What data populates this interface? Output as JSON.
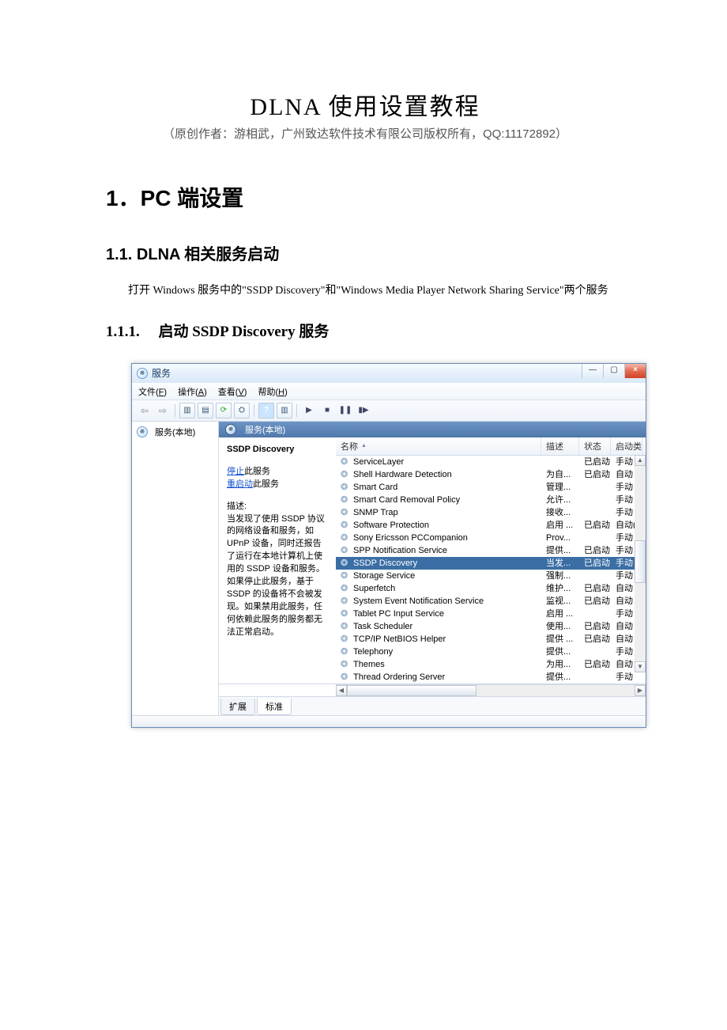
{
  "doc": {
    "title": "DLNA 使用设置教程",
    "subtitle": "（原创作者：游相武，广州致达软件技术有限公司版权所有，QQ:11172892）",
    "h1": "1．PC 端设置",
    "h2": "1.1. DLNA 相关服务启动",
    "p1": "打开 Windows 服务中的\"SSDP Discovery\"和\"Windows Media Player Network Sharing Service\"两个服务",
    "h3": "1.1.1.　 启动 SSDP Discovery 服务"
  },
  "win": {
    "title": "服务",
    "btn_min": "—",
    "btn_max": "▢",
    "btn_close": "×",
    "menus": {
      "file": {
        "label": "文件",
        "hot": "F"
      },
      "action": {
        "label": "操作",
        "hot": "A"
      },
      "view": {
        "label": "查看",
        "hot": "V"
      },
      "help": {
        "label": "帮助",
        "hot": "H"
      }
    },
    "nav_label": "服务(本地)",
    "caption_label": "服务(本地)",
    "detail": {
      "selected_name": "SSDP Discovery",
      "stop_link": "停止",
      "stop_suffix": "此服务",
      "restart_link": "重启动",
      "restart_suffix": "此服务",
      "desc_label": "描述:",
      "desc_text": "当发现了使用 SSDP 协议的网络设备和服务，如 UPnP 设备，同时还报告了运行在本地计算机上使用的 SSDP 设备和服务。如果停止此服务，基于 SSDP 的设备将不会被发现。如果禁用此服务，任何依赖此服务的服务都无法正常启动。"
    },
    "columns": {
      "name": "名称",
      "desc": "描述",
      "state": "状态",
      "startup": "启动类"
    },
    "rows": [
      {
        "name": "ServiceLayer",
        "desc": "",
        "state": "已启动",
        "startup": "手动",
        "sel": false
      },
      {
        "name": "Shell Hardware Detection",
        "desc": "为自...",
        "state": "已启动",
        "startup": "自动",
        "sel": false
      },
      {
        "name": "Smart Card",
        "desc": "管理...",
        "state": "",
        "startup": "手动",
        "sel": false
      },
      {
        "name": "Smart Card Removal Policy",
        "desc": "允许...",
        "state": "",
        "startup": "手动",
        "sel": false
      },
      {
        "name": "SNMP Trap",
        "desc": "接收...",
        "state": "",
        "startup": "手动",
        "sel": false
      },
      {
        "name": "Software Protection",
        "desc": "启用 ...",
        "state": "已启动",
        "startup": "自动(延",
        "sel": false
      },
      {
        "name": "Sony Ericsson PCCompanion",
        "desc": "Prov...",
        "state": "",
        "startup": "手动",
        "sel": false
      },
      {
        "name": "SPP Notification Service",
        "desc": "提供...",
        "state": "已启动",
        "startup": "手动",
        "sel": false
      },
      {
        "name": "SSDP Discovery",
        "desc": "当发...",
        "state": "已启动",
        "startup": "手动",
        "sel": true
      },
      {
        "name": "Storage Service",
        "desc": "强制...",
        "state": "",
        "startup": "手动",
        "sel": false
      },
      {
        "name": "Superfetch",
        "desc": "维护...",
        "state": "已启动",
        "startup": "自动",
        "sel": false
      },
      {
        "name": "System Event Notification Service",
        "desc": "监视...",
        "state": "已启动",
        "startup": "自动",
        "sel": false
      },
      {
        "name": "Tablet PC Input Service",
        "desc": "启用 ...",
        "state": "",
        "startup": "手动",
        "sel": false
      },
      {
        "name": "Task Scheduler",
        "desc": "使用...",
        "state": "已启动",
        "startup": "自动",
        "sel": false
      },
      {
        "name": "TCP/IP NetBIOS Helper",
        "desc": "提供 ...",
        "state": "已启动",
        "startup": "自动",
        "sel": false
      },
      {
        "name": "Telephony",
        "desc": "提供...",
        "state": "",
        "startup": "手动",
        "sel": false
      },
      {
        "name": "Themes",
        "desc": "为用...",
        "state": "已启动",
        "startup": "自动",
        "sel": false
      },
      {
        "name": "Thread Ordering Server",
        "desc": "提供...",
        "state": "",
        "startup": "手动",
        "sel": false
      }
    ],
    "tabs": {
      "extended": "扩展",
      "standard": "标准"
    }
  }
}
